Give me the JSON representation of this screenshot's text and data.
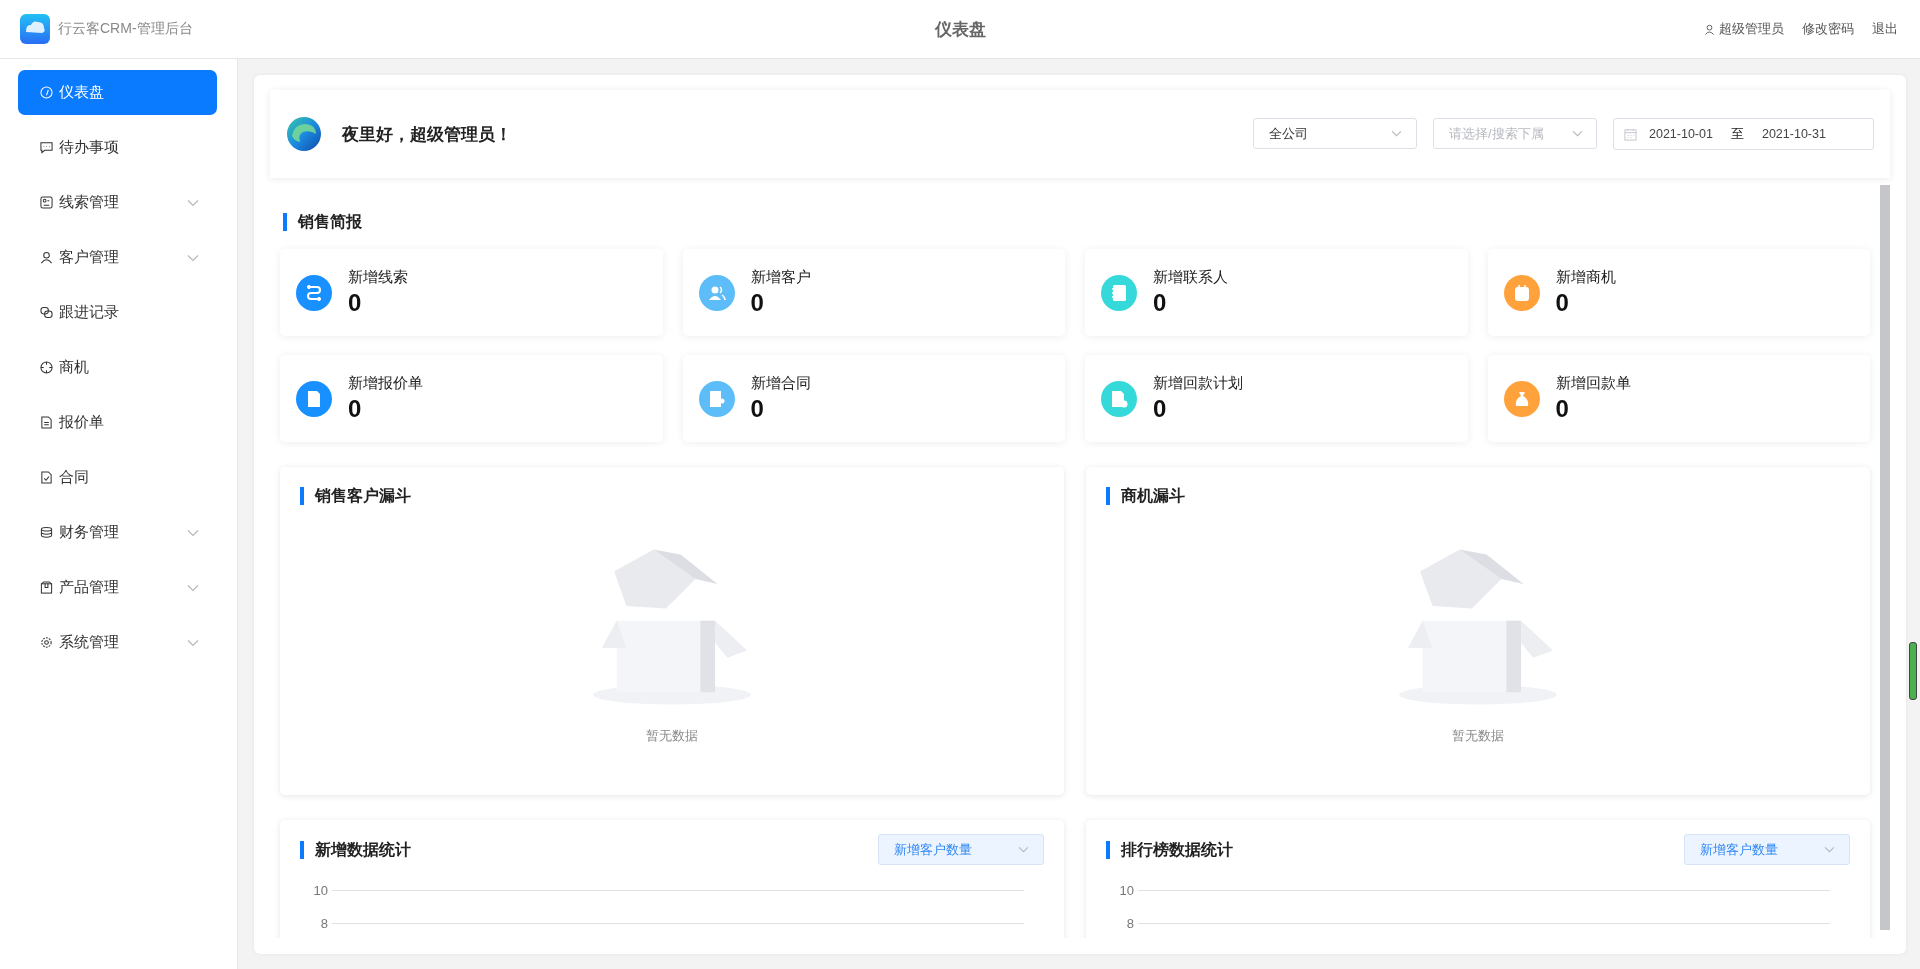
{
  "app": {
    "title": "行云客CRM-管理后台"
  },
  "header": {
    "page_title": "仪表盘",
    "user": "超级管理员",
    "links": [
      "修改密码",
      "退出"
    ]
  },
  "sidebar": {
    "items": [
      {
        "label": "仪表盘",
        "kind": "gauge",
        "selected": true,
        "expandable": false
      },
      {
        "label": "待办事项",
        "kind": "chat",
        "selected": false,
        "expandable": false
      },
      {
        "label": "线索管理",
        "kind": "clue",
        "selected": false,
        "expandable": true
      },
      {
        "label": "客户管理",
        "kind": "person",
        "selected": false,
        "expandable": true
      },
      {
        "label": "跟进记录",
        "kind": "links",
        "selected": false,
        "expandable": false
      },
      {
        "label": "商机",
        "kind": "target",
        "selected": false,
        "expandable": false
      },
      {
        "label": "报价单",
        "kind": "doc",
        "selected": false,
        "expandable": false
      },
      {
        "label": "合同",
        "kind": "doccheck",
        "selected": false,
        "expandable": false
      },
      {
        "label": "财务管理",
        "kind": "coins",
        "selected": false,
        "expandable": true
      },
      {
        "label": "产品管理",
        "kind": "box",
        "selected": false,
        "expandable": true
      },
      {
        "label": "系统管理",
        "kind": "gear",
        "selected": false,
        "expandable": true
      }
    ]
  },
  "greeting": "夜里好，超级管理员！",
  "filters": {
    "scope": {
      "value": "全公司"
    },
    "subordinate": {
      "placeholder": "请选择/搜索下属"
    },
    "date_range": {
      "start": "2021-10-01",
      "separator": "至",
      "end": "2021-10-31"
    }
  },
  "sales_brief": {
    "title": "销售简报",
    "stats": [
      {
        "label": "新增线索",
        "value": "0",
        "kind": "route",
        "color": "#1890ff"
      },
      {
        "label": "新增客户",
        "value": "0",
        "kind": "people",
        "color": "#5cbdf8"
      },
      {
        "label": "新增联系人",
        "value": "0",
        "kind": "contacts",
        "color": "#36d9d9"
      },
      {
        "label": "新增商机",
        "value": "0",
        "kind": "dollar",
        "color": "#ffa23c"
      },
      {
        "label": "新增报价单",
        "value": "0",
        "kind": "invoice",
        "color": "#1890ff"
      },
      {
        "label": "新增合同",
        "value": "0",
        "kind": "contract",
        "color": "#5cbdf8"
      },
      {
        "label": "新增回款计划",
        "value": "0",
        "kind": "plan",
        "color": "#36d9d9"
      },
      {
        "label": "新增回款单",
        "value": "0",
        "kind": "bag",
        "color": "#ffa23c"
      }
    ]
  },
  "funnels": [
    {
      "title": "销售客户漏斗",
      "empty_text": "暂无数据"
    },
    {
      "title": "商机漏斗",
      "empty_text": "暂无数据"
    }
  ],
  "stat_charts": [
    {
      "title": "新增数据统计",
      "metric": "新增客户数量",
      "y_ticks": [
        "10",
        "8"
      ]
    },
    {
      "title": "排行榜数据统计",
      "metric": "新增客户数量",
      "y_ticks": [
        "10",
        "8"
      ]
    }
  ]
}
